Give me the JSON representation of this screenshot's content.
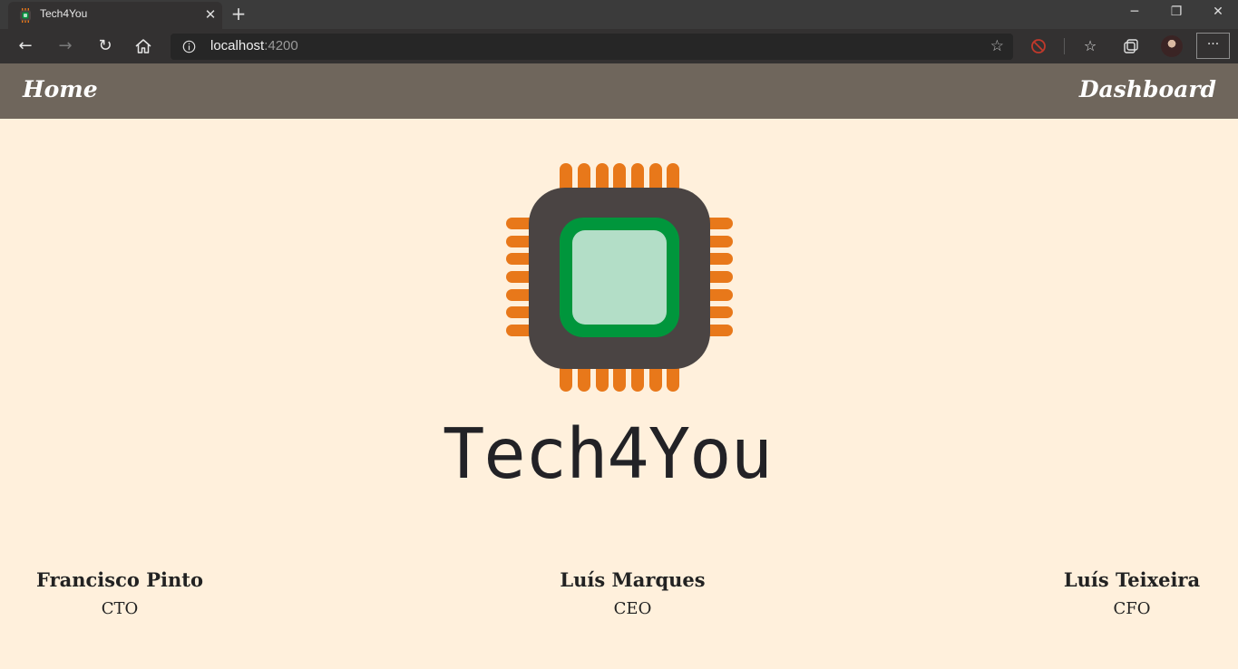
{
  "browser": {
    "tab_title": "Tech4You",
    "address_host": "localhost",
    "address_port": ":4200",
    "new_tab_label": "+",
    "close_tab_label": "✕",
    "more_label": "···",
    "window_controls": {
      "minimize": "─",
      "restore": "❐",
      "close": "✕"
    }
  },
  "nav": {
    "home_label": "Home",
    "dashboard_label": "Dashboard"
  },
  "hero": {
    "brand_name": "Tech4You",
    "logo_icon": "cpu-chip-icon"
  },
  "team": [
    {
      "name": "Francisco Pinto",
      "role": "CTO"
    },
    {
      "name": "Luís Marques",
      "role": "CEO"
    },
    {
      "name": "Luís Teixeira",
      "role": "CFO"
    }
  ],
  "colors": {
    "page_background": "#fff0dc",
    "nav_background": "#6f665c",
    "chip_body": "#4a4443",
    "chip_pins": "#e8781a",
    "chip_core_border": "#00963c",
    "chip_core_fill": "#b3dec7",
    "brand_text": "#222226"
  }
}
